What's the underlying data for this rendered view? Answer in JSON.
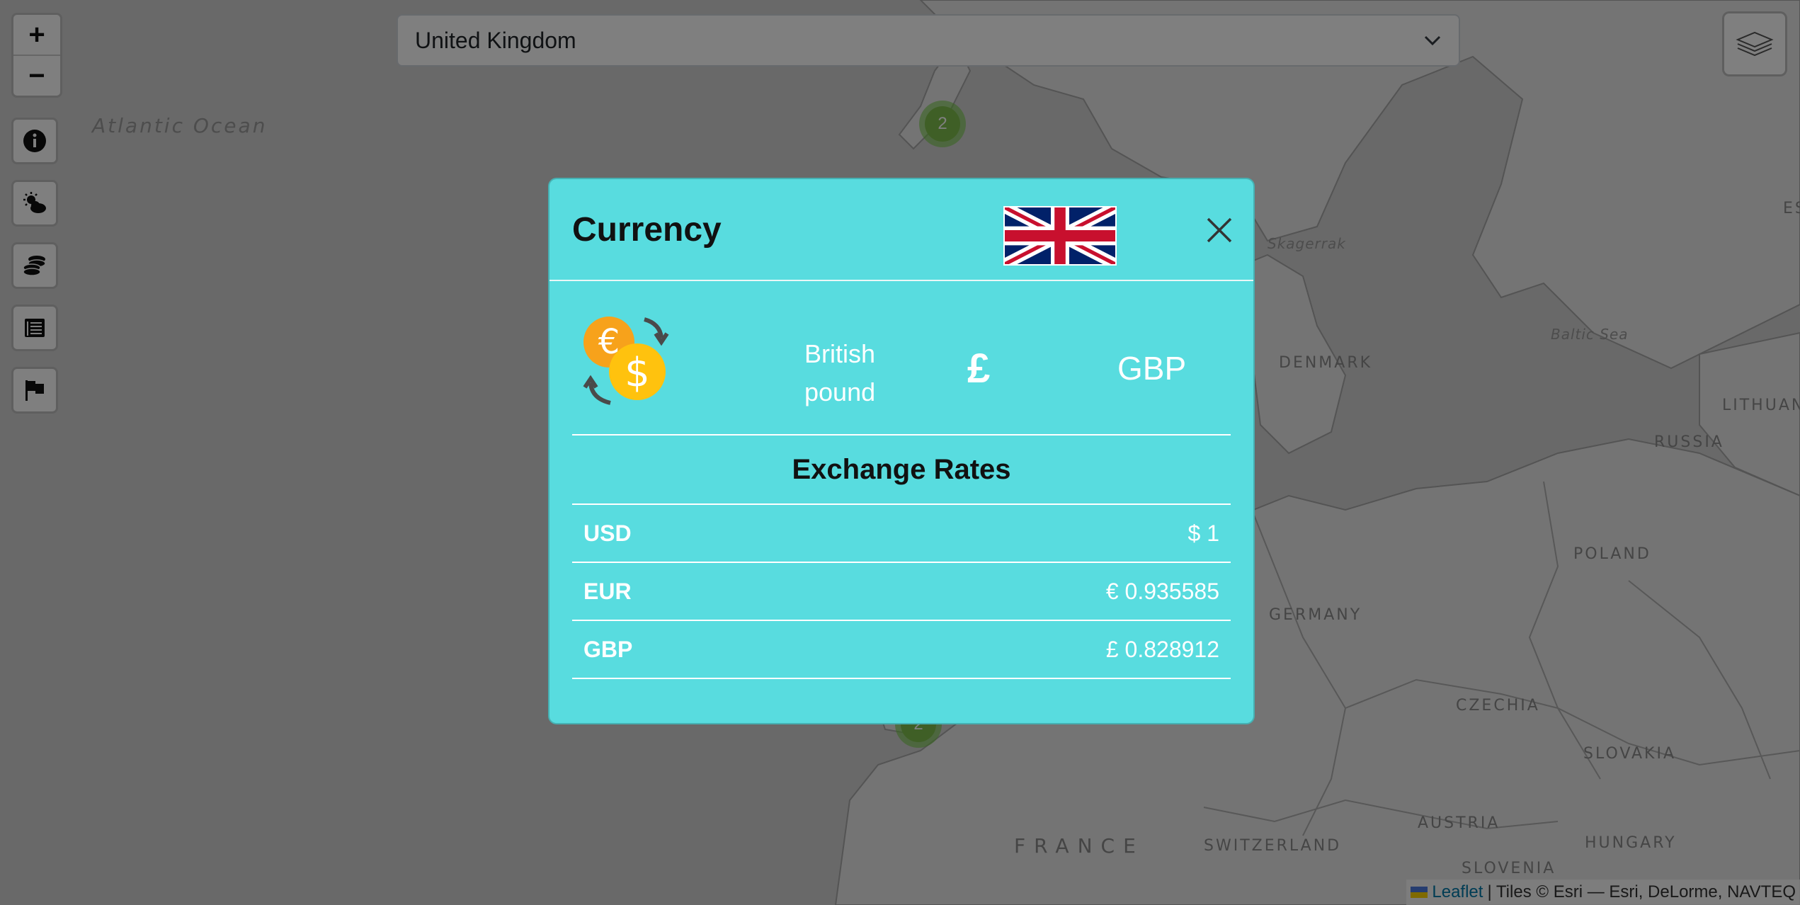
{
  "search": {
    "selected_country": "United Kingdom"
  },
  "map": {
    "labels": {
      "atlantic_ocean": "Atlantic Ocean",
      "skagerrak": "Skagerrak",
      "baltic_sea": "Baltic Sea",
      "denmark": "DENMARK",
      "lithuania": "LITHUANI",
      "russia": "RUSSIA",
      "poland": "POLAND",
      "germany": "GERMANY",
      "czechia": "CZECHIA",
      "slovakia": "SLOVAKIA",
      "austria": "AUSTRIA",
      "hungary": "HUNGARY",
      "slovenia": "SLOVENIA",
      "switzerland": "SWITZERLAND",
      "france": "FRANCE",
      "es_partial": "ES"
    },
    "clusters": [
      {
        "count": "2"
      },
      {
        "count": "2"
      }
    ]
  },
  "controls": {
    "zoom_in": "+",
    "zoom_out": "−",
    "buttons": [
      "info-icon",
      "weather-icon",
      "coins-icon",
      "news-icon",
      "flag-icon"
    ]
  },
  "attribution": {
    "leaflet": "Leaflet",
    "tiles": "| Tiles © Esri — Esri, DeLorme, NAVTEQ"
  },
  "modal": {
    "title": "Currency",
    "currency_name": "British pound",
    "currency_symbol": "£",
    "currency_code": "GBP",
    "rates_title": "Exchange Rates",
    "rates": [
      {
        "code": "USD",
        "value": "$ 1"
      },
      {
        "code": "EUR",
        "value": "€ 0.935585"
      },
      {
        "code": "GBP",
        "value": "£ 0.828912"
      }
    ]
  },
  "colors": {
    "modal_bg": "#58dcdf",
    "cluster": "#7fbf4d",
    "leaflet_link": "#0078a8"
  }
}
